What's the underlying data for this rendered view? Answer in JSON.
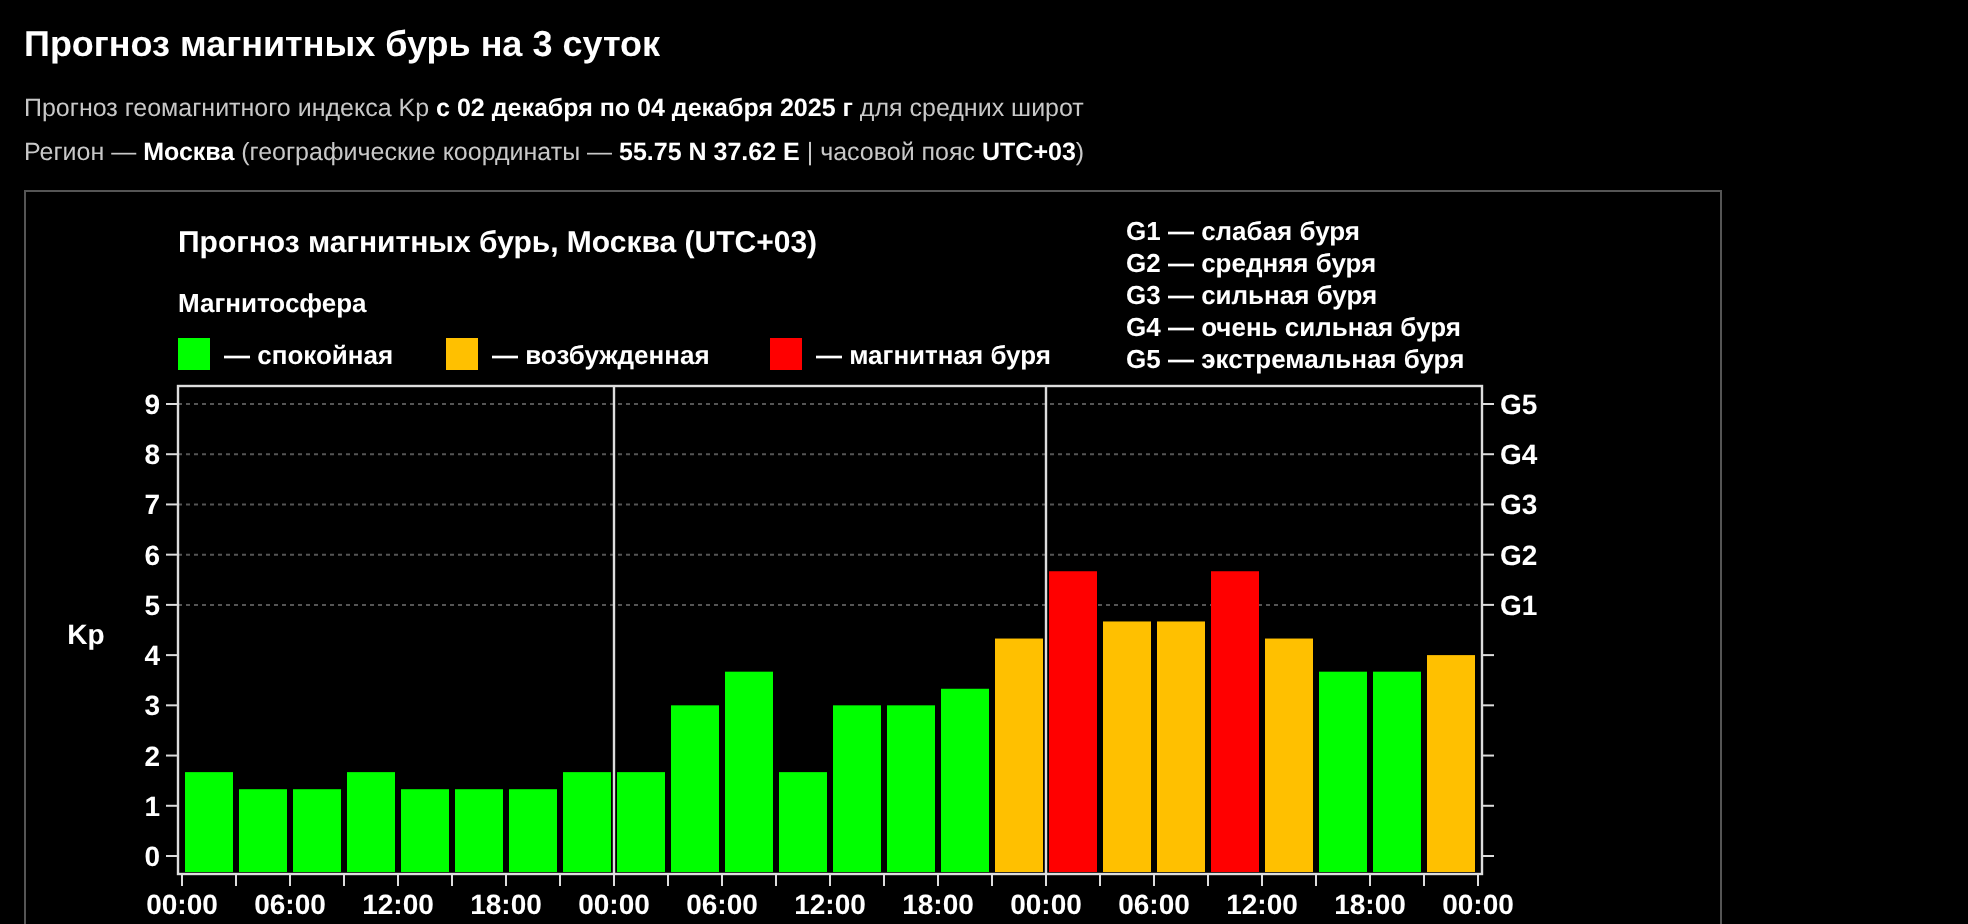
{
  "header": {
    "title": "Прогноз магнитных бурь на 3 суток",
    "lines": [
      "Прогноз геомагнитного индекса Kp **с 02 декабря по 04 декабря 2025 г** для средних широт",
      "Регион — **Москва** (географические координаты — **55.75 N 37.62 E** | часовой пояс **UTC+03**)"
    ]
  },
  "chart": {
    "title": "Прогноз магнитных бурь, Москва (UTC+03)",
    "legend_title": "Магнитосфера",
    "legend": [
      {
        "label": "— спокойная",
        "color": "#00ff00"
      },
      {
        "label": "— возбужденная",
        "color": "#ffc000"
      },
      {
        "label": "— магнитная буря",
        "color": "#ff0000"
      }
    ],
    "storm_scale": [
      "G1 — слабая буря",
      "G2 — средняя буря",
      "G3 — сильная буря",
      "G4 — очень сильная буря",
      "G5 — экстремальная буря"
    ],
    "storm_axis": [
      "G5",
      "G4",
      "G3",
      "G2",
      "G1"
    ],
    "x_axis_labels": [
      "00:00",
      "06:00",
      "12:00",
      "18:00",
      "00:00",
      "06:00",
      "12:00",
      "18:00",
      "00:00",
      "06:00",
      "12:00",
      "18:00",
      "00:00"
    ],
    "chart_data": {
      "type": "bar",
      "ylabel": "Kp",
      "grid": true,
      "categories": [
        null,
        null,
        null,
        null,
        null,
        null,
        null,
        null,
        null,
        null,
        null,
        null,
        null,
        null,
        null,
        null,
        null,
        null,
        null,
        null,
        null,
        null,
        null,
        null
      ],
      "ylim": [
        0,
        9
      ],
      "yticks": [
        0,
        1,
        2,
        3,
        4,
        5,
        6,
        7,
        8,
        9
      ],
      "series": [
        {
          "values": [
            1.67,
            1.33,
            1.33,
            1.67,
            1.33,
            1.33,
            1.33,
            1.67,
            1.67,
            3,
            3.67,
            1.67,
            3,
            3,
            3.33,
            4.33,
            5.67,
            4.67,
            4.67,
            5.67,
            4.33,
            3.67,
            3.67,
            4
          ]
        }
      ]
    }
  }
}
